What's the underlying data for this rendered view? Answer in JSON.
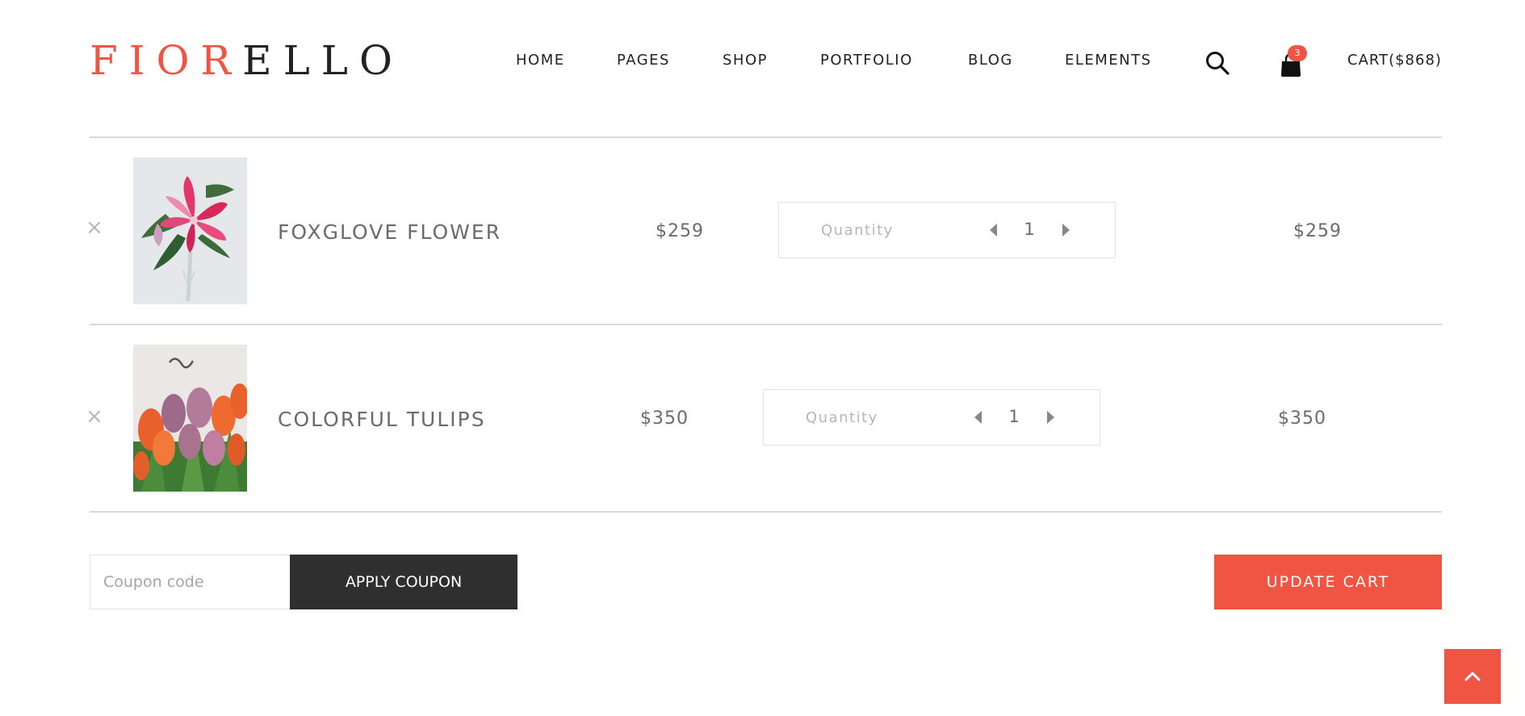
{
  "brand": {
    "part1": "FIOR",
    "part2": "ELLO",
    "accent_color": "#f05442"
  },
  "nav": {
    "items": [
      "HOME",
      "PAGES",
      "SHOP",
      "PORTFOLIO",
      "BLOG",
      "ELEMENTS"
    ],
    "search_icon": "search-icon",
    "cart_icon": "shopping-bag-icon",
    "cart_badge": "3",
    "cart_total": "CART($868)"
  },
  "cart": {
    "remove_symbol": "×",
    "items": [
      {
        "name": "FOXGLOVE FLOWER",
        "price": "$259",
        "quantity_label": "Quantity",
        "quantity": "1",
        "subtotal": "$259",
        "image": "pink-lily-in-glass-vase"
      },
      {
        "name": "COLORFUL TULIPS",
        "price": "$350",
        "quantity_label": "Quantity",
        "quantity": "1",
        "subtotal": "$350",
        "image": "orange-and-purple-tulip-bouquet"
      }
    ]
  },
  "coupon": {
    "placeholder": "Coupon code",
    "value": "",
    "apply_label": "APPLY COUPON"
  },
  "update_label": "UPDATE CART",
  "scroll_top_icon": "chevron-up-icon"
}
